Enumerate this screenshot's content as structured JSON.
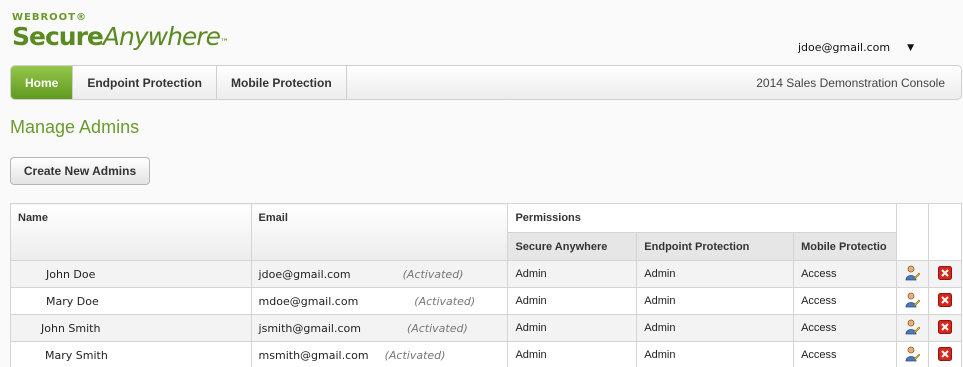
{
  "logo": {
    "brand": "WEBROOT",
    "reg": "®",
    "product_bold": "Secure",
    "product_italic": "Anywhere",
    "tm": "™"
  },
  "user_menu": {
    "email": "jdoe@gmail.com",
    "caret": "▼"
  },
  "nav": {
    "tabs": [
      {
        "label": "Home",
        "active": true
      },
      {
        "label": "Endpoint Protection",
        "active": false
      },
      {
        "label": "Mobile Protection",
        "active": false
      }
    ],
    "console_name": "2014 Sales Demonstration Console"
  },
  "page": {
    "title": "Manage Admins",
    "create_button": "Create New Admins"
  },
  "table": {
    "headers": {
      "name": "Name",
      "email": "Email",
      "permissions": "Permissions"
    },
    "permission_headers": [
      "Secure Anywhere",
      "Endpoint Protection",
      "Mobile Protectio"
    ],
    "rows": [
      {
        "name": "John Doe",
        "email": "jdoe@gmail.com",
        "status": "(Activated)",
        "secure_anywhere": "Admin",
        "endpoint_protection": "Admin",
        "mobile_protection": "Access"
      },
      {
        "name": "Mary Doe",
        "email": "mdoe@gmail.com",
        "status": "(Activated)",
        "secure_anywhere": "Admin",
        "endpoint_protection": "Admin",
        "mobile_protection": "Access"
      },
      {
        "name": "John Smith",
        "email": "jsmith@gmail.com",
        "status": "(Activated)",
        "secure_anywhere": "Admin",
        "endpoint_protection": "Admin",
        "mobile_protection": "Access"
      },
      {
        "name": "Mary Smith",
        "email": "msmith@gmail.com",
        "status": "(Activated)",
        "secure_anywhere": "Admin",
        "endpoint_protection": "Admin",
        "mobile_protection": "Access"
      }
    ],
    "row_icons": {
      "edit": "edit-user-icon",
      "delete": "delete-icon"
    }
  },
  "colors": {
    "brand_green": "#6b9b2e",
    "tab_active": "#5f9a1f",
    "delete_red": "#d9261c"
  }
}
